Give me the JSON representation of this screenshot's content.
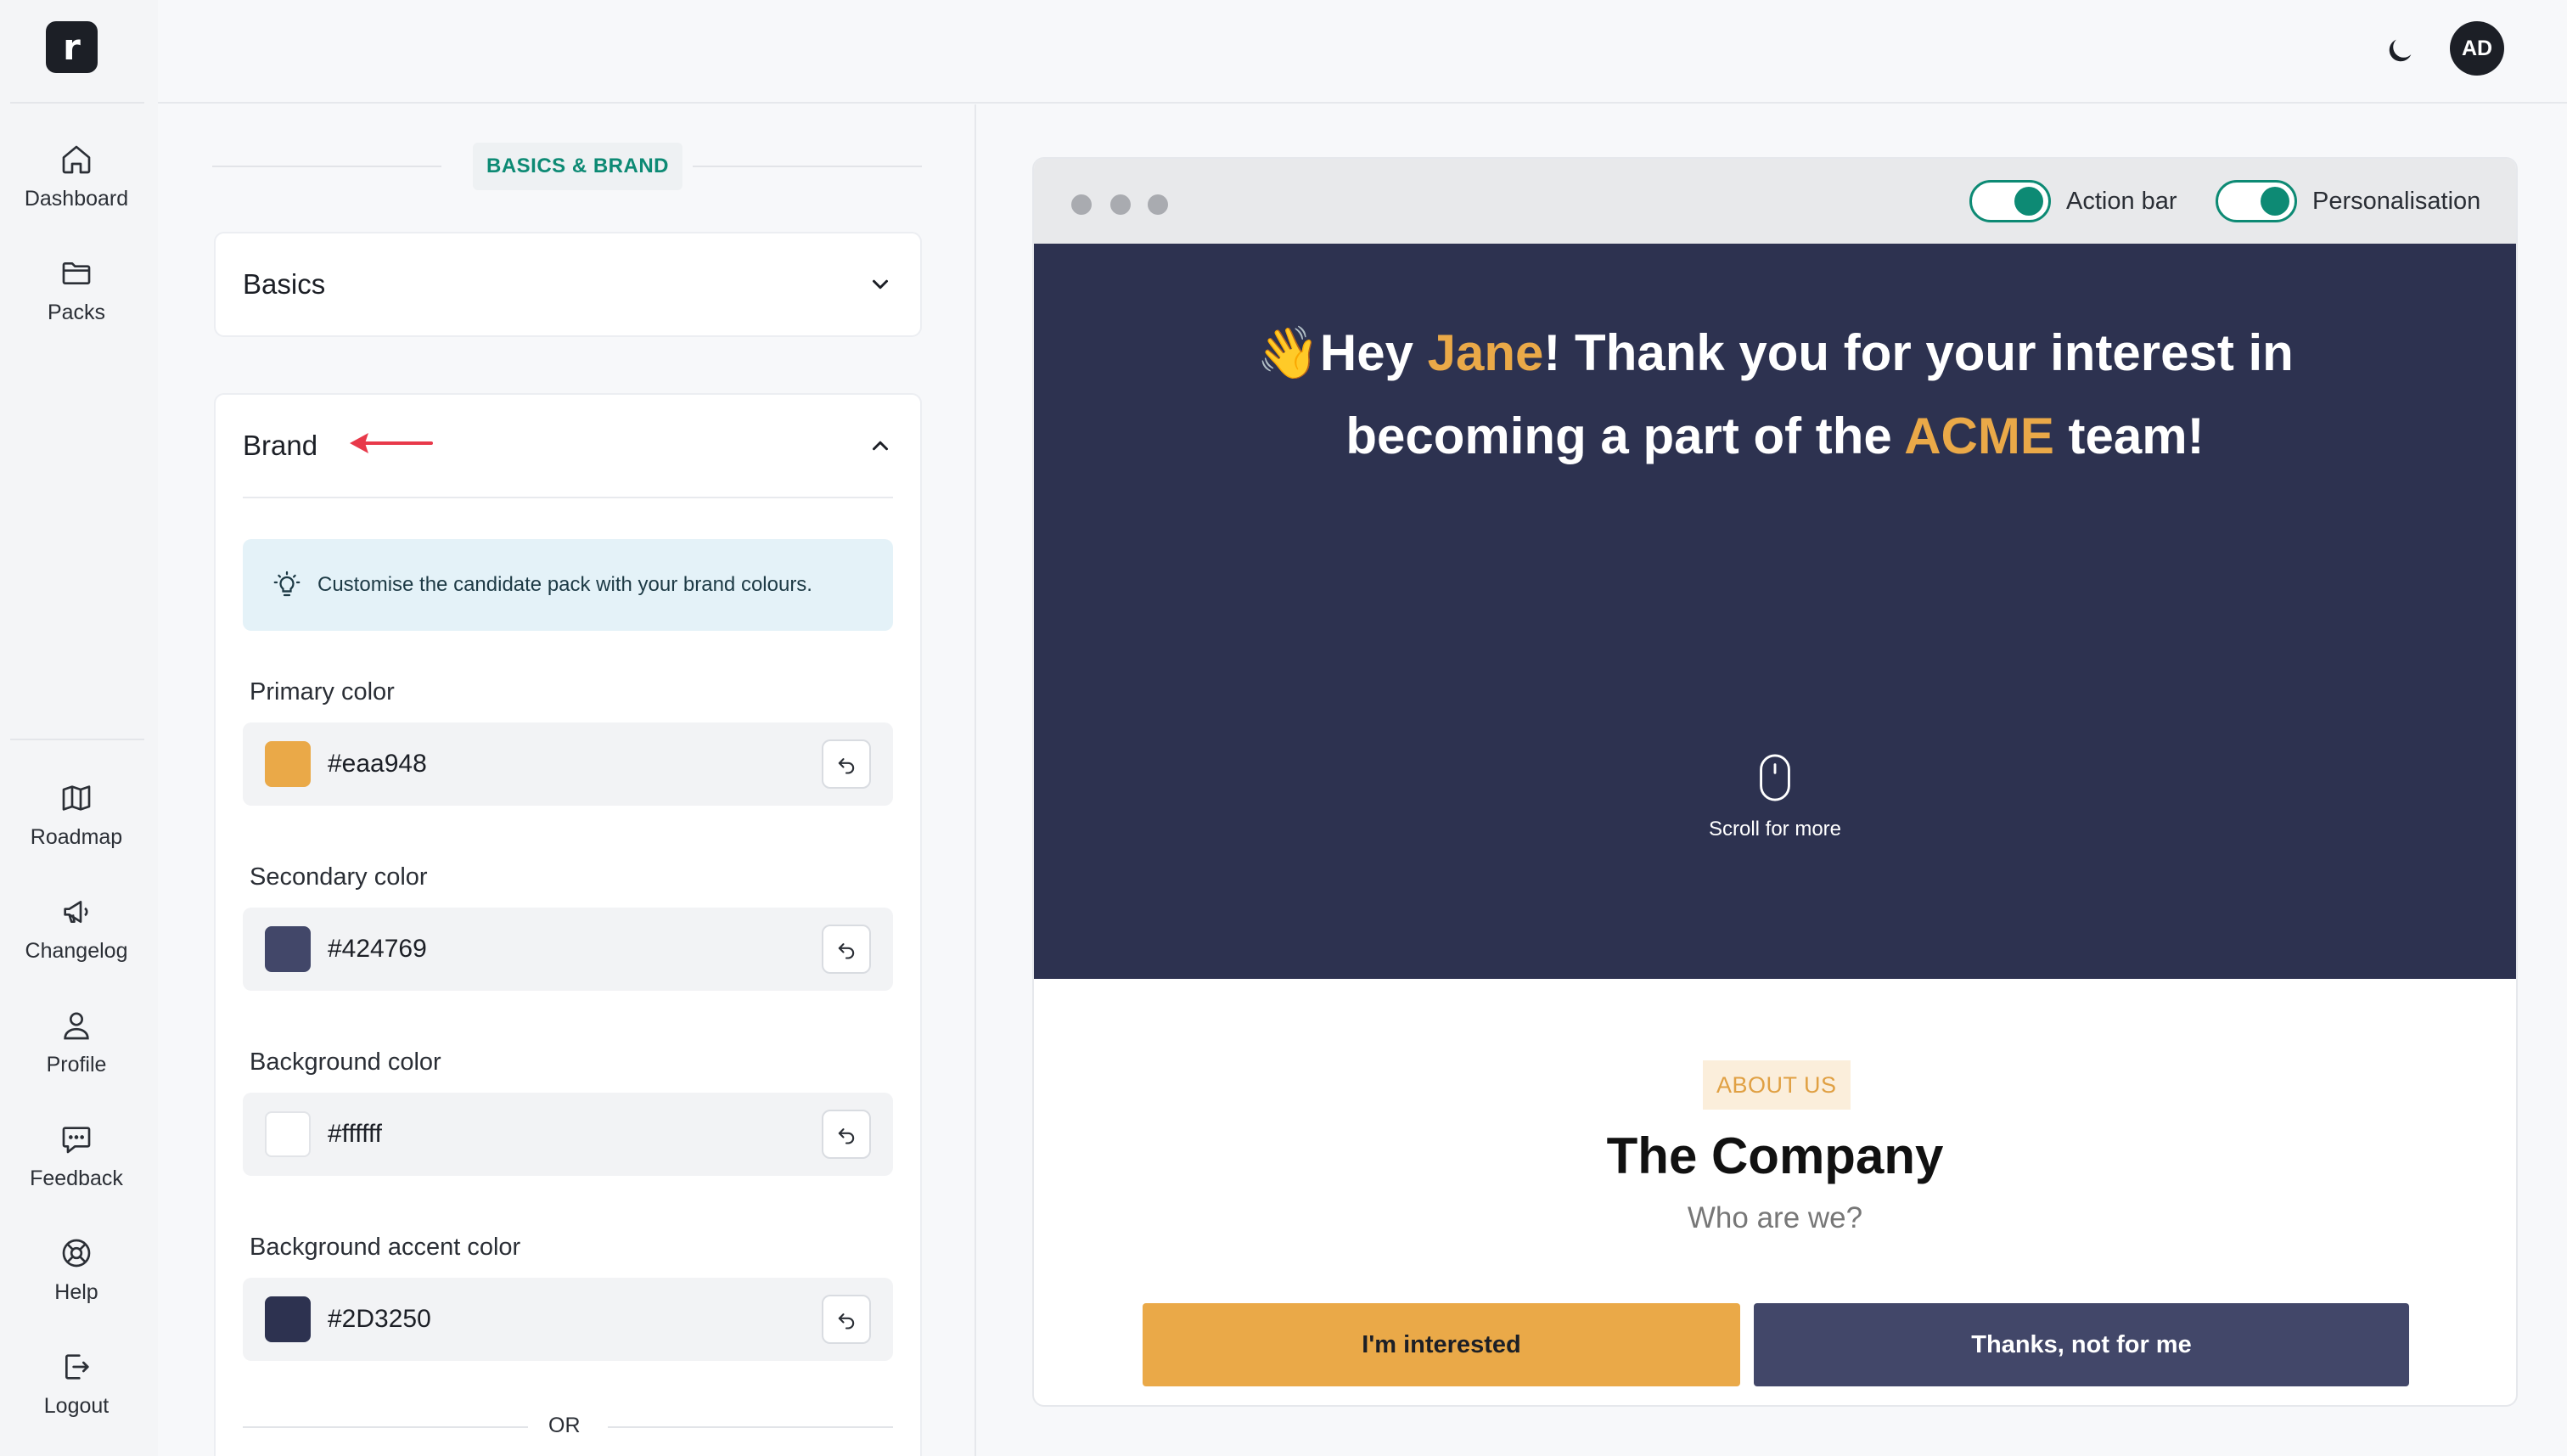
{
  "app": {
    "logo_letter": "r"
  },
  "sidebar": {
    "top_items": [
      {
        "label": "Dashboard",
        "icon": "home-icon"
      },
      {
        "label": "Packs",
        "icon": "folder-icon"
      }
    ],
    "bottom_items": [
      {
        "label": "Roadmap",
        "icon": "map-icon"
      },
      {
        "label": "Changelog",
        "icon": "megaphone-icon"
      },
      {
        "label": "Profile",
        "icon": "user-icon"
      },
      {
        "label": "Feedback",
        "icon": "chat-icon"
      },
      {
        "label": "Help",
        "icon": "lifebuoy-icon"
      },
      {
        "label": "Logout",
        "icon": "logout-icon"
      }
    ]
  },
  "topbar": {
    "avatar_initials": "AD",
    "theme_icon": "moon-icon"
  },
  "editor": {
    "section_title": "BASICS & BRAND",
    "basics": {
      "title": "Basics",
      "expanded": false
    },
    "brand": {
      "title": "Brand",
      "expanded": true,
      "tip": "Customise the candidate pack with your brand colours.",
      "fields": [
        {
          "label": "Primary color",
          "value": "#eaa948",
          "swatch": "#eaa948"
        },
        {
          "label": "Secondary color",
          "value": "#424769",
          "swatch": "#424769"
        },
        {
          "label": "Background color",
          "value": "#ffffff",
          "swatch": "#ffffff"
        },
        {
          "label": "Background accent color",
          "value": "#2D3250",
          "swatch": "#2D3250"
        }
      ],
      "or_label": "OR"
    }
  },
  "preview": {
    "toggles": [
      {
        "label": "Action bar",
        "on": true
      },
      {
        "label": "Personalisation",
        "on": true
      }
    ],
    "hero": {
      "emoji": "👋",
      "greeting_prefix": "Hey ",
      "name": "Jane",
      "line1_rest": "! Thank you for your interest in",
      "line2_prefix": "becoming a part of the ",
      "company_token": "ACME",
      "line2_suffix": " team!",
      "scroll_label": "Scroll for more"
    },
    "about": {
      "chip": "ABOUT US",
      "title": "The Company",
      "subtitle": "Who are we?"
    },
    "buttons": {
      "primary": "I'm interested",
      "secondary": "Thanks, not for me"
    }
  },
  "colors": {
    "accent": "#0d8a74",
    "primary": "#eaa948",
    "secondary": "#424769",
    "hero_bg": "#2D3250",
    "annotation_arrow": "#e8394a"
  }
}
